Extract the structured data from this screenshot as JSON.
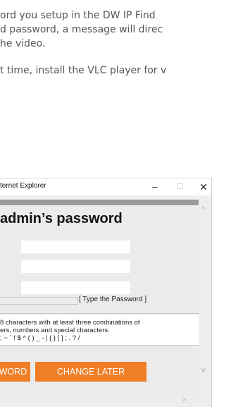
{
  "document": {
    "lines": [
      "ord you setup in the DW IP Find",
      "d password, a message will direc",
      "he video.",
      "t time, install the VLC player for v"
    ]
  },
  "window": {
    "title": "ternet Explorer",
    "controls": {
      "minimize": "–",
      "maximize": "☐",
      "close": "✕"
    }
  },
  "dialog": {
    "heading": "admin’s password",
    "strength_label": "[ Type the Password ]",
    "strength_level": 0,
    "rules": [
      " 8 characters with at least three combinations of",
      "ers, numbers and special characters.",
      "; ~ ` ! $ ^ ( ) _ - | { } [ ] ; . ? /"
    ],
    "buttons": {
      "change_password": "WORD",
      "change_later": "CHANGE LATER"
    }
  },
  "scroll": {
    "up": "^",
    "down": "v",
    "right": ">"
  }
}
